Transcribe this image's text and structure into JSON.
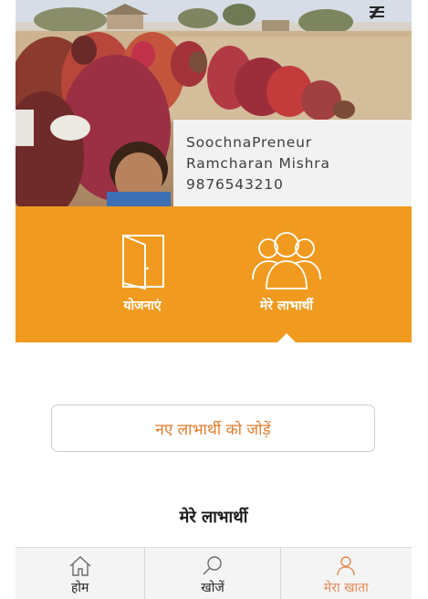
{
  "header": {
    "icons": [
      "edit-pencil-icon",
      "hamburger-menu-icon"
    ]
  },
  "profile": {
    "role": "SoochnaPreneur",
    "name": "Ramcharan Mishra",
    "phone": "9876543210"
  },
  "quick_tiles": [
    {
      "label": "योजनाएं",
      "icon": "folder-icon"
    },
    {
      "label": "मेरे लाभार्थी",
      "icon": "users-group-icon",
      "selected": true
    }
  ],
  "actions": {
    "add_beneficiary_label": "नए लाभार्थी को जोड़ें"
  },
  "section": {
    "title": "मेरे लाभार्थी"
  },
  "tabbar": {
    "tabs": [
      {
        "label": "होम",
        "icon": "home-icon"
      },
      {
        "label": "खोजें",
        "icon": "search-icon"
      },
      {
        "label": "मेरा खाता",
        "icon": "user-icon",
        "active": true
      }
    ]
  },
  "colors": {
    "accent": "#f09b1f",
    "active_tab": "#e58a55",
    "button_text": "#e07b2a"
  }
}
